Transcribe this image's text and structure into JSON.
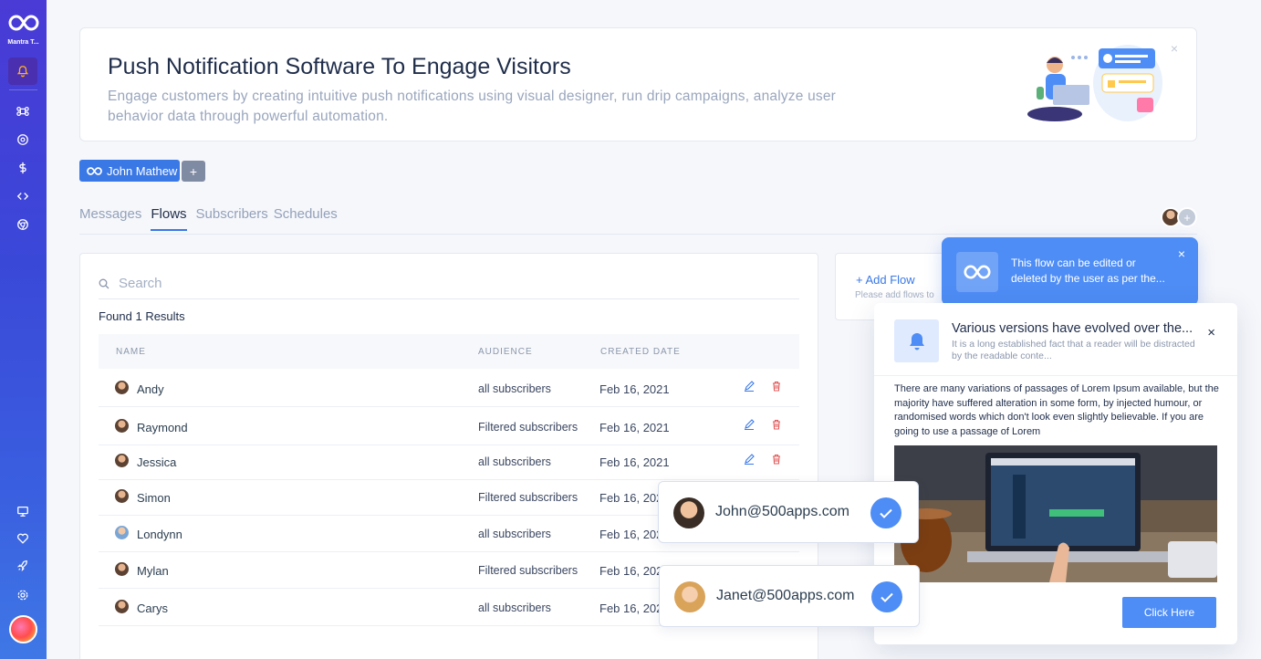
{
  "sidebar": {
    "brand": "Mantra T...",
    "icons": [
      "bell-icon",
      "command-icon",
      "aperture-icon",
      "dollar-icon",
      "code-icon",
      "chrome-icon",
      "monitor-icon",
      "heart-icon",
      "rocket-icon",
      "settings-icon"
    ]
  },
  "banner": {
    "title": "Push Notification Software To Engage Visitors",
    "description": "Engage customers by creating intuitive push notifications using visual designer, run drip campaigns, analyze user behavior data through powerful automation.",
    "close": "×"
  },
  "workspace": {
    "name": "John Mathew",
    "add": "+"
  },
  "tabs": [
    {
      "label": "Messages",
      "active": false
    },
    {
      "label": "Flows",
      "active": true
    },
    {
      "label": "Subscribers",
      "active": false
    },
    {
      "label": "Schedules",
      "active": false
    }
  ],
  "table": {
    "search_placeholder": "Search",
    "found": "Found 1 Results",
    "columns": [
      "NAME",
      "AUDIENCE",
      "CREATED DATE"
    ],
    "rows": [
      {
        "name": "Andy",
        "audience": "all subscribers",
        "date": "Feb 16, 2021"
      },
      {
        "name": "Raymond",
        "audience": "Filtered subscribers",
        "date": "Feb 16, 2021"
      },
      {
        "name": "Jessica",
        "audience": "all subscribers",
        "date": "Feb 16, 2021"
      },
      {
        "name": "Simon",
        "audience": "Filtered subscribers",
        "date": "Feb 16, 202"
      },
      {
        "name": "Londynn",
        "audience": "all subscribers",
        "date": "Feb 16, 202"
      },
      {
        "name": "Mylan",
        "audience": "Filtered subscribers",
        "date": "Feb 16, 202"
      },
      {
        "name": "Carys",
        "audience": "all subscribers",
        "date": "Feb 16, 202"
      }
    ]
  },
  "flowcard": {
    "add_label": "+  Add Flow",
    "hint": "Please add flows to"
  },
  "tooltip": {
    "text": "This flow can be edited or deleted by the user as per the...",
    "close": "×"
  },
  "push": {
    "title": "Various versions have evolved over the...",
    "subtitle": "It is a long established fact that a reader will be distracted by the readable conte...",
    "body": "There are many variations of passages of Lorem Ipsum available, but the majority have suffered alteration in some form, by injected humour, or randomised words which don't look even slightly believable. If you are going to use a passage of Lorem",
    "button": "Click Here",
    "close": "×"
  },
  "emails": [
    {
      "address": "John@500apps.com"
    },
    {
      "address": "Janet@500apps.com"
    }
  ],
  "colors": {
    "accent": "#4e8df5",
    "primary": "#3a78e6",
    "delete": "#e05a5a"
  }
}
